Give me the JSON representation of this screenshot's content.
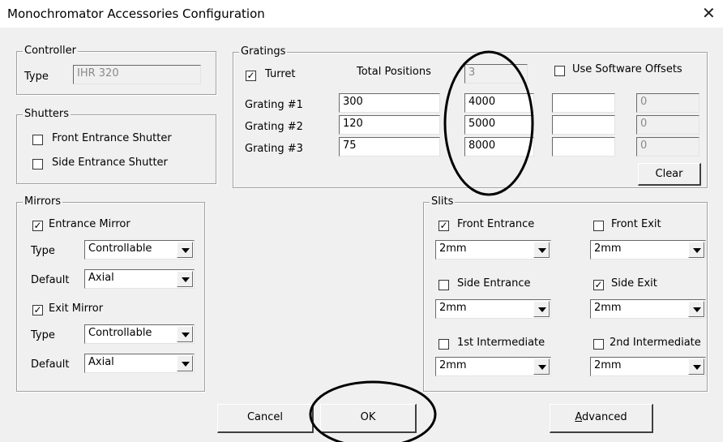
{
  "window": {
    "title": "Monochromator Accessories Configuration",
    "close_glyph": "✕"
  },
  "controller": {
    "legend": "Controller",
    "type_label": "Type",
    "type_value": "IHR 320"
  },
  "shutters": {
    "legend": "Shutters",
    "front": {
      "label": "Front Entrance Shutter",
      "checked": false
    },
    "side": {
      "label": "Side Entrance Shutter",
      "checked": false
    }
  },
  "gratings": {
    "legend": "Gratings",
    "turret_label": "Turret",
    "turret_checked": true,
    "total_positions_label": "Total Positions",
    "total_positions_value": "3",
    "use_offsets_label": "Use Software Offsets",
    "use_offsets_checked": false,
    "rows": [
      {
        "label": "Grating #1",
        "a": "300",
        "b": "4000",
        "c": "",
        "d": "0"
      },
      {
        "label": "Grating #2",
        "a": "120",
        "b": "5000",
        "c": "",
        "d": "0"
      },
      {
        "label": "Grating #3",
        "a": "75",
        "b": "8000",
        "c": "",
        "d": "0"
      }
    ],
    "clear_label": "Clear"
  },
  "mirrors": {
    "legend": "Mirrors",
    "entrance_label": "Entrance Mirror",
    "entrance_checked": true,
    "entrance_type_label": "Type",
    "entrance_type_value": "Controllable",
    "entrance_default_label": "Default",
    "entrance_default_value": "Axial",
    "exit_label": "Exit Mirror",
    "exit_checked": true,
    "exit_type_label": "Type",
    "exit_type_value": "Controllable",
    "exit_default_label": "Default",
    "exit_default_value": "Axial"
  },
  "slits": {
    "legend": "Slits",
    "items": [
      {
        "label": "Front Entrance",
        "checked": true,
        "value": "2mm"
      },
      {
        "label": "Front Exit",
        "checked": false,
        "value": "2mm"
      },
      {
        "label": "Side Entrance",
        "checked": false,
        "value": "2mm"
      },
      {
        "label": "Side Exit",
        "checked": true,
        "value": "2mm"
      },
      {
        "label": "1st Intermediate",
        "checked": false,
        "value": "2mm"
      },
      {
        "label": "2nd Intermediate",
        "checked": false,
        "value": "2mm"
      }
    ]
  },
  "buttons": {
    "cancel": "Cancel",
    "ok": "OK",
    "advanced_first": "A",
    "advanced_rest": "dvanced"
  },
  "glyphs": {
    "check": "✓"
  },
  "annotations": {
    "color": "#000000"
  }
}
